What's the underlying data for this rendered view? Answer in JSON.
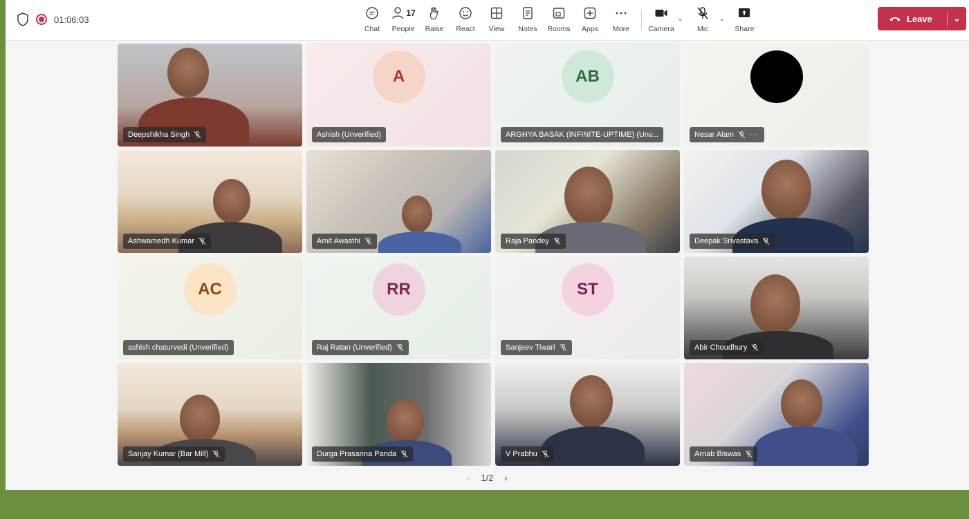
{
  "meeting": {
    "timer": "01:06:03"
  },
  "toolbar": {
    "chat": "Chat",
    "people": "People",
    "people_count": "17",
    "raise": "Raise",
    "react": "React",
    "view": "View",
    "notes": "Notes",
    "rooms": "Rooms",
    "apps": "Apps",
    "more": "More",
    "camera": "Camera",
    "mic": "Mic",
    "share": "Share",
    "leave": "Leave"
  },
  "participants": [
    {
      "name": "Deepshikha Singh",
      "muted": true
    },
    {
      "name": "Ashish (Unverified)",
      "initials": "A",
      "avatar_bg": "#f6d5c9",
      "avatar_color": "#a3382b"
    },
    {
      "name": "ARGHYA BASAK (INFINITE-UPTIME) (Unv...",
      "initials": "AB",
      "avatar_bg": "#cfe9d9",
      "avatar_color": "#2d6a45"
    },
    {
      "name": "Nesar Alam",
      "muted": true,
      "more": "···"
    },
    {
      "name": "Ashwamedh Kumar",
      "muted": true
    },
    {
      "name": "Amit Awasthi",
      "muted": true
    },
    {
      "name": "Raja Pandey",
      "muted": true
    },
    {
      "name": "Deepak Srivastava",
      "muted": true
    },
    {
      "name": "ashish chaturvedi (Unverified)",
      "initials": "AC",
      "avatar_bg": "#fce4c7",
      "avatar_color": "#8a4b12"
    },
    {
      "name": "Raj Ratan (Unverified)",
      "muted": true,
      "initials": "RR",
      "avatar_bg": "#f0d3e0",
      "avatar_color": "#7a2950"
    },
    {
      "name": "Sanjeev Tiwari",
      "muted": true,
      "initials": "ST",
      "avatar_bg": "#f4d2e2",
      "avatar_color": "#7a2350"
    },
    {
      "name": "Abir Choudhury",
      "muted": true
    },
    {
      "name": "Sanjay Kumar (Bar Mill)",
      "muted": true
    },
    {
      "name": "Durga Prasanna Panda",
      "muted": true
    },
    {
      "name": "V Prabhu",
      "muted": true
    },
    {
      "name": "Arnab Biswas",
      "muted": true
    }
  ],
  "pager": {
    "text": "1/2"
  }
}
